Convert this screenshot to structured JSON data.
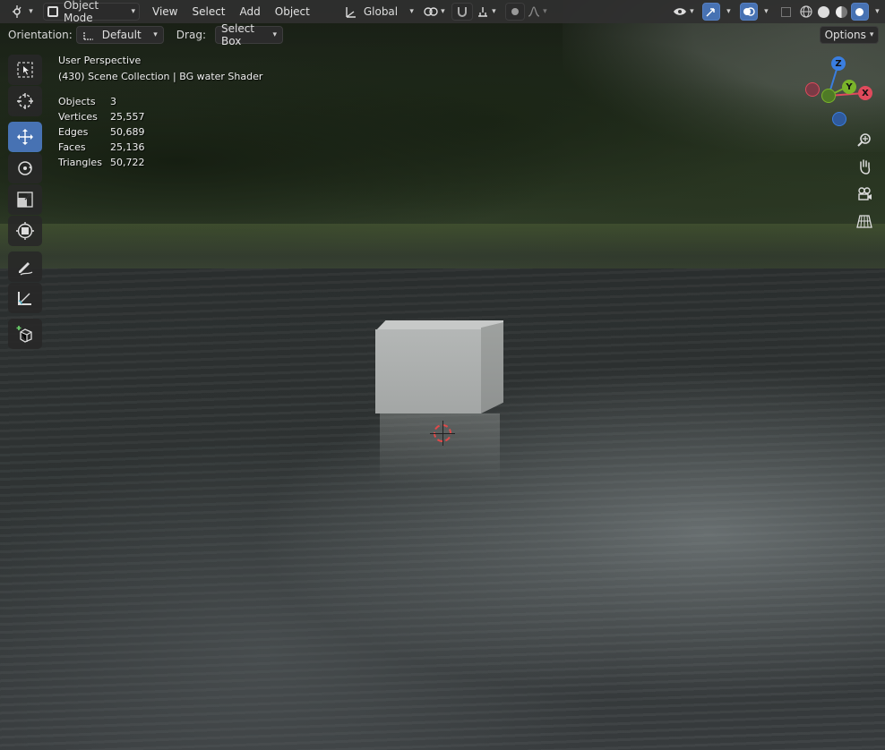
{
  "header": {
    "mode_label": "Object Mode",
    "menus": [
      "View",
      "Select",
      "Add",
      "Object"
    ],
    "transform_orientation": "Global"
  },
  "tool_settings": {
    "orientation_label": "Orientation:",
    "orientation_value": "Default",
    "drag_label": "Drag:",
    "drag_value": "Select Box",
    "options_label": "Options"
  },
  "overlay": {
    "view_name": "User Perspective",
    "collection_line": "(430) Scene Collection | BG water Shader",
    "stats": [
      {
        "key": "Objects",
        "value": "3"
      },
      {
        "key": "Vertices",
        "value": "25,557"
      },
      {
        "key": "Edges",
        "value": "50,689"
      },
      {
        "key": "Faces",
        "value": "25,136"
      },
      {
        "key": "Triangles",
        "value": "50,722"
      }
    ]
  },
  "gizmo": {
    "axes": [
      "Z",
      "Y",
      "X"
    ],
    "colors": {
      "x": "#e04a5c",
      "y": "#7ab42a",
      "z": "#3a7ee0"
    }
  },
  "tools": [
    "select-box",
    "cursor",
    "move",
    "rotate",
    "scale",
    "transform",
    "annotate",
    "measure",
    "add-cube"
  ],
  "colors": {
    "accent": "#4772b3"
  }
}
